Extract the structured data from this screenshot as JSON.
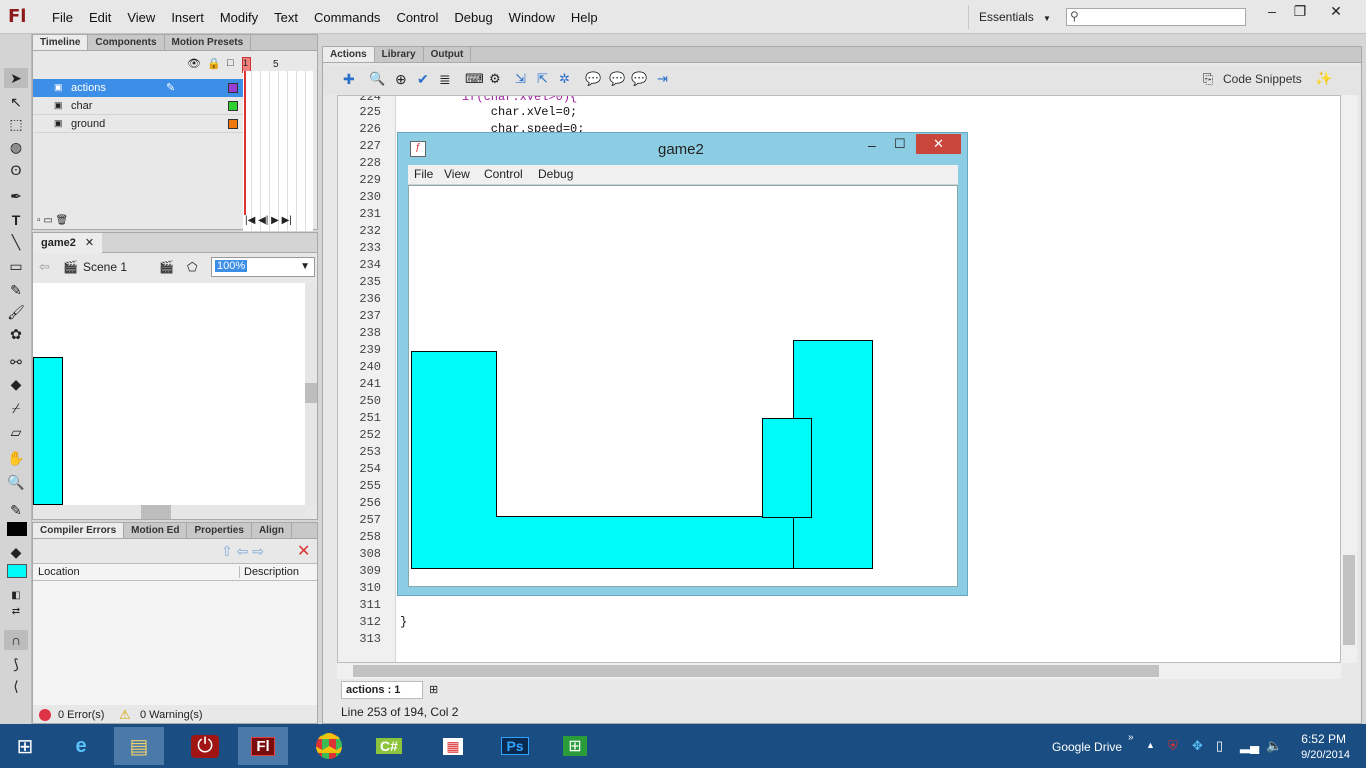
{
  "app": {
    "logo": "Fl",
    "menu": [
      "File",
      "Edit",
      "View",
      "Insert",
      "Modify",
      "Text",
      "Commands",
      "Control",
      "Debug",
      "Window",
      "Help"
    ],
    "workspace": "Essentials",
    "window_controls": [
      "minimize",
      "maximize",
      "close"
    ]
  },
  "timeline_panel": {
    "tabs": [
      "Timeline",
      "Components",
      "Motion Presets"
    ],
    "frame_numbers": [
      "1",
      "5"
    ],
    "layers": [
      {
        "name": "actions",
        "color": "#9b3cd6"
      },
      {
        "name": "char",
        "color": "#2fd12f"
      },
      {
        "name": "ground",
        "color": "#f07a10"
      }
    ]
  },
  "stage_panel": {
    "doc_tab": "game2",
    "scene": "Scene 1",
    "zoom": "100%"
  },
  "compiler_panel": {
    "tabs": [
      "Compiler Errors",
      "Motion Ed",
      "Properties",
      "Align"
    ],
    "columns": [
      "Location",
      "Description"
    ],
    "errors": "0 Error(s)",
    "warnings": "0 Warning(s)"
  },
  "actions_panel": {
    "tabs": [
      "Actions",
      "Library",
      "Output"
    ],
    "code_snippets": "Code Snippets",
    "line_numbers": [
      "225",
      "226",
      "227",
      "228",
      "229",
      "230",
      "231",
      "232",
      "233",
      "234",
      "235",
      "236",
      "237",
      "238",
      "239",
      "240",
      "241",
      "250",
      "251",
      "252",
      "253",
      "254",
      "255",
      "256",
      "257",
      "258",
      "308",
      "309",
      "310",
      "311",
      "312",
      "313"
    ],
    "top_line_partial": "if(char.xVel>0){",
    "code_lines": [
      {
        "text": "    char.xVel=0;"
      },
      {
        "text": "    char.speed=0;"
      },
      {
        "text": "}"
      }
    ],
    "script_tab": "actions : 1",
    "status": "Line 253 of 194, Col 2"
  },
  "game_window": {
    "title": "game2",
    "menu": [
      "File",
      "View",
      "Control",
      "Debug"
    ],
    "fill_color": "#00fbfb"
  },
  "taskbar": {
    "pinned": [
      "windows",
      "internet-explorer",
      "file-explorer",
      "power",
      "flash",
      "chrome",
      "csharp",
      "app-grid",
      "photoshop",
      "store"
    ],
    "tray_label": "Google Drive",
    "time": "6:52 PM",
    "date": "9/20/2014"
  }
}
